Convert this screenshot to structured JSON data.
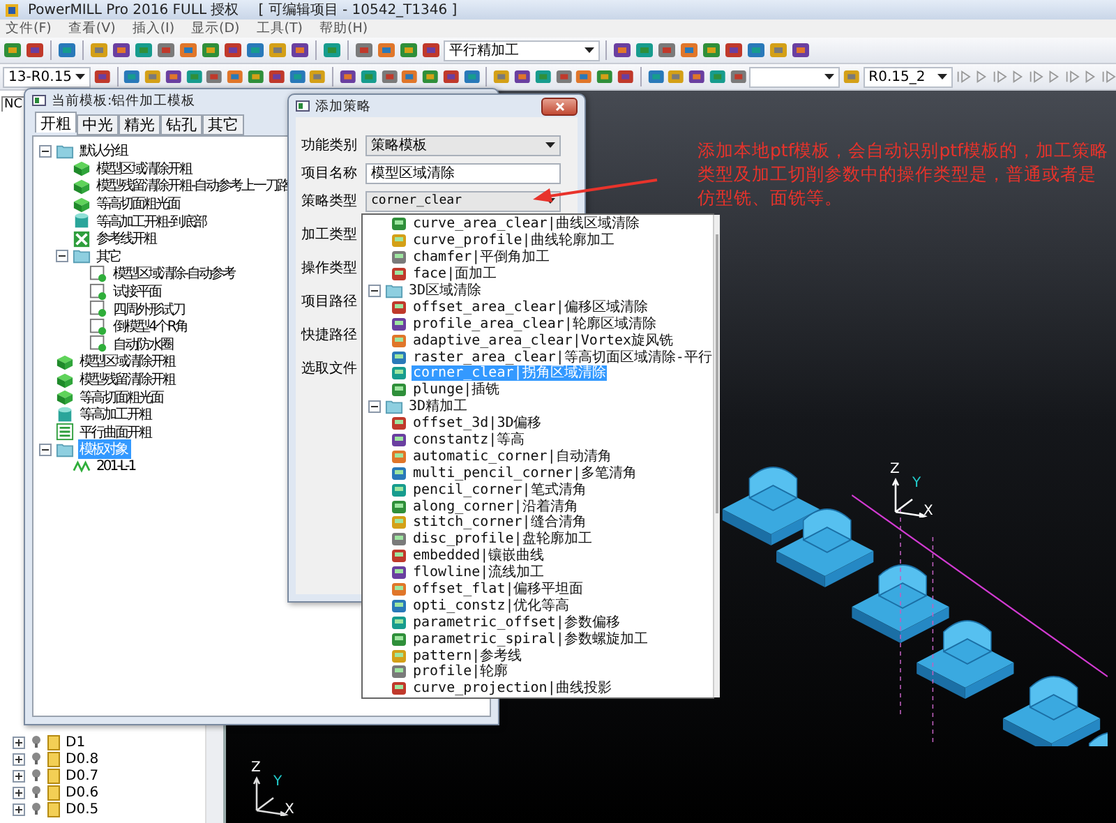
{
  "window": {
    "title": "PowerMILL Pro 2016 FULL 授权",
    "project": "[ 可编辑项目 - 10542_T1346 ]"
  },
  "menu": [
    "文件(F)",
    "查看(V)",
    "插入(I)",
    "显示(D)",
    "工具(T)",
    "帮助(H)"
  ],
  "toolbar": {
    "strategy_combo": "平行精加工",
    "tool_combo": "13-R0.15",
    "boundary_combo": "R0.15_2"
  },
  "explorer": {
    "tab": "NC",
    "items": [
      {
        "label": "D1",
        "expanded": false
      },
      {
        "label": "D0.8",
        "expanded": false
      },
      {
        "label": "D0.7",
        "expanded": false
      },
      {
        "label": "D0.6",
        "expanded": false
      },
      {
        "label": "D0.5",
        "expanded": false
      }
    ]
  },
  "template_window": {
    "title": "当前模板:铝件加工模板",
    "tabs": [
      {
        "label": "开粗",
        "selected": true
      },
      {
        "label": "中光",
        "selected": false
      },
      {
        "label": "精光",
        "selected": false
      },
      {
        "label": "钻孔",
        "selected": false
      },
      {
        "label": "其它",
        "selected": false
      }
    ],
    "tree": [
      {
        "label": "默认分组",
        "kind": "group",
        "expanded": true,
        "selected": false,
        "children": [
          {
            "label": "模型区域清除开粗",
            "kind": "block",
            "selected": false
          },
          {
            "label": "模型残留清除开粗-自动参考上一刀路",
            "kind": "block",
            "selected": false
          },
          {
            "label": "等高切面粗光面",
            "kind": "block",
            "selected": false
          },
          {
            "label": "等高加工开粗-到底部",
            "kind": "cylinder",
            "selected": false
          },
          {
            "label": "参考线开粗",
            "kind": "pattern",
            "selected": false
          },
          {
            "label": "其它",
            "kind": "group",
            "expanded": true,
            "selected": false,
            "children": [
              {
                "label": "模型区域清除-自动参考",
                "kind": "template",
                "selected": false
              },
              {
                "label": "试接平面",
                "kind": "template",
                "selected": false
              },
              {
                "label": "四周外形试刀",
                "kind": "template",
                "selected": false
              },
              {
                "label": "倒模型4个R角",
                "kind": "template",
                "selected": false
              },
              {
                "label": "自动防水圈",
                "kind": "template",
                "selected": false
              }
            ]
          }
        ]
      },
      {
        "label": "模型区域清除开粗",
        "kind": "block",
        "selected": false
      },
      {
        "label": "模型残留清除开粗",
        "kind": "block",
        "selected": false
      },
      {
        "label": "等高切面粗光面",
        "kind": "block",
        "selected": false
      },
      {
        "label": "等高加工开粗",
        "kind": "cylinder",
        "selected": false
      },
      {
        "label": "平行曲面开粗",
        "kind": "lines",
        "selected": false
      },
      {
        "label": "模板对象",
        "kind": "group",
        "expanded": true,
        "selected": true,
        "children": [
          {
            "label": "201-L-1",
            "kind": "toolpath",
            "selected": false
          }
        ]
      }
    ]
  },
  "dialog": {
    "title": "添加策略",
    "fields": [
      {
        "label": "功能类别",
        "kind": "select",
        "value": "策略模板"
      },
      {
        "label": "项目名称",
        "kind": "text",
        "value": "模型区域清除"
      },
      {
        "label": "策略类型",
        "kind": "select",
        "value": "corner_clear"
      },
      {
        "label": "加工类型",
        "kind": "label"
      },
      {
        "label": "操作类型",
        "kind": "label"
      },
      {
        "label": "项目路径",
        "kind": "label"
      },
      {
        "label": "快捷路径",
        "kind": "label"
      },
      {
        "label": "选取文件",
        "kind": "label"
      }
    ]
  },
  "strategy_list": [
    {
      "kind": "item",
      "label": "curve_area_clear|曲线区域清除",
      "selected": false
    },
    {
      "kind": "item",
      "label": "curve_profile|曲线轮廓加工",
      "selected": false
    },
    {
      "kind": "item",
      "label": "chamfer|平倒角加工",
      "selected": false
    },
    {
      "kind": "item",
      "label": "face|面加工",
      "selected": false
    },
    {
      "kind": "group",
      "label": "3D区域清除",
      "expanded": true,
      "selected": false,
      "children": [
        {
          "kind": "item",
          "label": "offset_area_clear|偏移区域清除",
          "selected": false
        },
        {
          "kind": "item",
          "label": "profile_area_clear|轮廓区域清除",
          "selected": false
        },
        {
          "kind": "item",
          "label": "adaptive_area_clear|Vortex旋风铣",
          "selected": false
        },
        {
          "kind": "item",
          "label": "raster_area_clear|等高切面区域清除-平行",
          "selected": false
        },
        {
          "kind": "item",
          "label": "corner_clear|拐角区域清除",
          "selected": true
        },
        {
          "kind": "item",
          "label": "plunge|插铣",
          "selected": false
        }
      ]
    },
    {
      "kind": "group",
      "label": "3D精加工",
      "expanded": true,
      "selected": false,
      "children": [
        {
          "kind": "item",
          "label": "offset_3d|3D偏移",
          "selected": false
        },
        {
          "kind": "item",
          "label": "constantz|等高",
          "selected": false
        },
        {
          "kind": "item",
          "label": "automatic_corner|自动清角",
          "selected": false
        },
        {
          "kind": "item",
          "label": "multi_pencil_corner|多笔清角",
          "selected": false
        },
        {
          "kind": "item",
          "label": "pencil_corner|笔式清角",
          "selected": false
        },
        {
          "kind": "item",
          "label": "along_corner|沿着清角",
          "selected": false
        },
        {
          "kind": "item",
          "label": "stitch_corner|缝合清角",
          "selected": false
        },
        {
          "kind": "item",
          "label": "disc_profile|盘轮廓加工",
          "selected": false
        },
        {
          "kind": "item",
          "label": "embedded|镶嵌曲线",
          "selected": false
        },
        {
          "kind": "item",
          "label": "flowline|流线加工",
          "selected": false
        },
        {
          "kind": "item",
          "label": "offset_flat|偏移平坦面",
          "selected": false
        },
        {
          "kind": "item",
          "label": "opti_constz|优化等高",
          "selected": false
        },
        {
          "kind": "item",
          "label": "parametric_offset|参数偏移",
          "selected": false
        },
        {
          "kind": "item",
          "label": "parametric_spiral|参数螺旋加工",
          "selected": false
        },
        {
          "kind": "item",
          "label": "pattern|参考线",
          "selected": false
        },
        {
          "kind": "item",
          "label": "profile|轮廓",
          "selected": false
        },
        {
          "kind": "item",
          "label": "curve_projection|曲线投影",
          "selected": false
        }
      ]
    }
  ],
  "annotation": "添加本地ptf模板，会自动识别ptf模板的，加工策略类型及加工切削参数中的操作类型是，普通或者是仿型铣、面铣等。",
  "viewport": {
    "triads": [
      {
        "z": "Z",
        "y": "Y",
        "x": "X"
      },
      {
        "z": "Z",
        "y": "Y",
        "x": "X"
      }
    ]
  }
}
